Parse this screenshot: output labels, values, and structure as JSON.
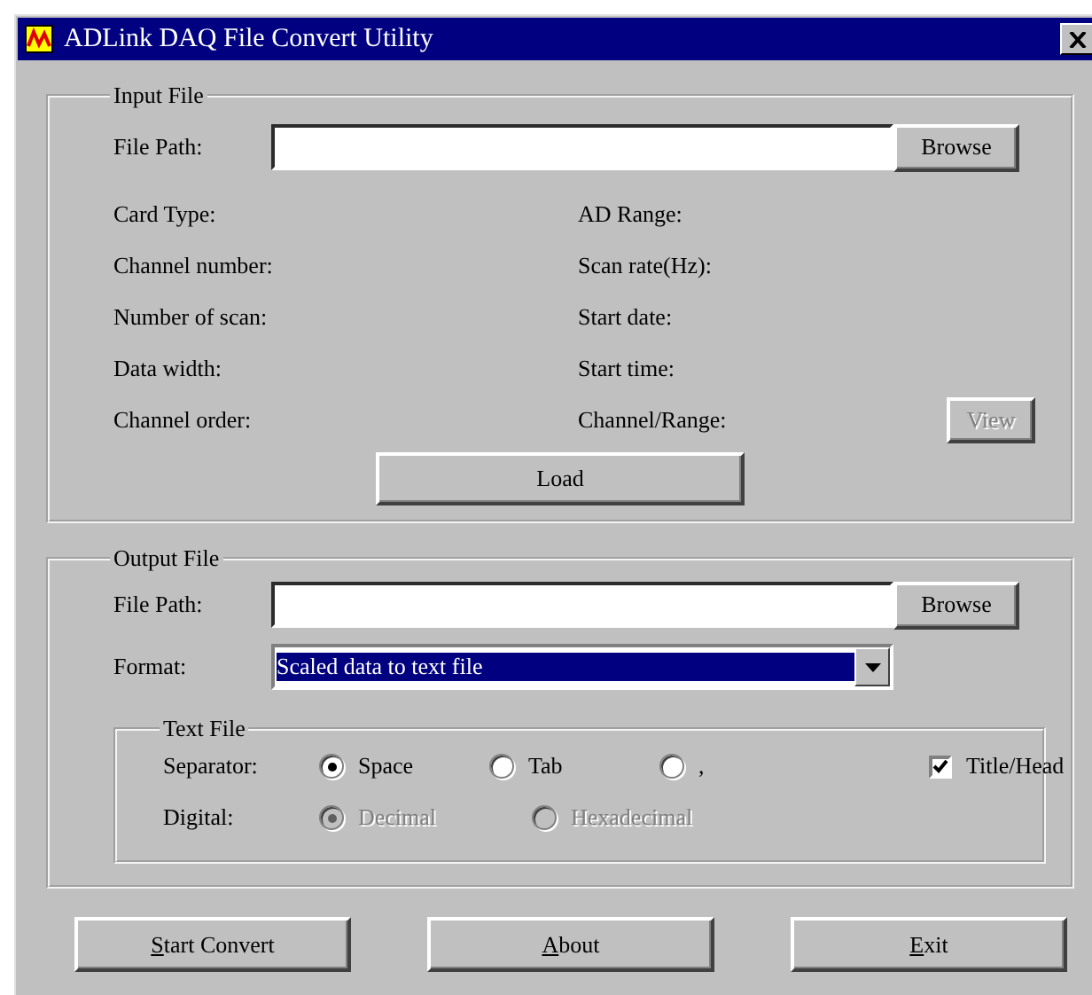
{
  "window": {
    "title": "ADLink DAQ File Convert Utility"
  },
  "input_file": {
    "legend": "Input File",
    "file_path_label": "File Path:",
    "browse_button": "Browse",
    "info_left": [
      "Card Type:",
      "Channel number:",
      "Number of scan:",
      "Data width:",
      "Channel order:"
    ],
    "info_right": [
      "AD Range:",
      "Scan rate(Hz):",
      "Start date:",
      "Start time:",
      "Channel/Range:"
    ],
    "view_button": {
      "label": "View",
      "disabled": true
    },
    "load_button": "Load"
  },
  "output_file": {
    "legend": "Output File",
    "file_path_label": "File Path:",
    "browse_button": "Browse",
    "format": {
      "label": "Format:",
      "value": "Scaled data to text file"
    },
    "text_file": {
      "legend": "Text File",
      "separator": {
        "label": "Separator:",
        "options": [
          {
            "label": "Space",
            "selected": true
          },
          {
            "label": "Tab",
            "selected": false
          },
          {
            "label": ",",
            "selected": false
          }
        ]
      },
      "title_head": {
        "label": "Title/Head",
        "checked": true
      },
      "digital": {
        "label": "Digital:",
        "disabled": true,
        "options": [
          {
            "label": "Decimal",
            "selected": true
          },
          {
            "label": "Hexadecimal",
            "selected": false
          }
        ]
      }
    }
  },
  "buttons": [
    {
      "label": "Start Convert",
      "underline_first_letter": true
    },
    {
      "label": "About",
      "underline_first_letter": true
    },
    {
      "label": "Exit",
      "underline_first_letter": true
    }
  ]
}
